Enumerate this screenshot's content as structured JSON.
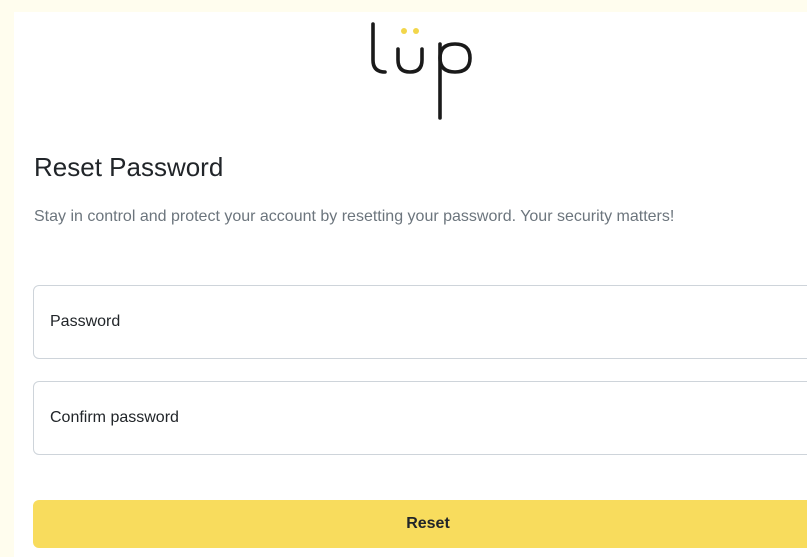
{
  "logo": {
    "text": "lüp",
    "icon": "lup-logo",
    "dot_color": "#f2d64b",
    "stroke_color": "#1a1a1a"
  },
  "title": "Reset Password",
  "description": "Stay in control and protect your account by resetting your password. Your security matters!",
  "form": {
    "password_placeholder": "Password",
    "password_value": "",
    "confirm_placeholder": "Confirm password",
    "confirm_value": "",
    "submit_label": "Reset"
  },
  "colors": {
    "accent": "#f8dc5d",
    "page_tint": "#fffdee",
    "muted_text": "#6c757d",
    "border": "#ced4da"
  }
}
